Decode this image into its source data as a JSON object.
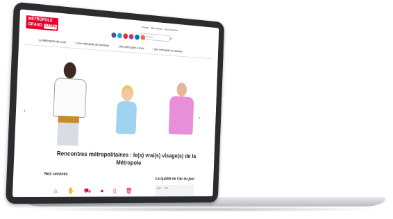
{
  "brand": {
    "line1": "MÉTROPOLE",
    "line2a": "GRAND",
    "line2b": "LYON"
  },
  "colors": {
    "accent": "#e4002b"
  },
  "header": {
    "top_links": [
      "Presse",
      "Aide et accès",
      "Nous contacter"
    ],
    "search_placeholder": "Rechercher",
    "social_icons": [
      "facebook-icon",
      "twitter-icon",
      "youtube-icon",
      "instagram-icon",
      "linkedin-icon",
      "rss-icon"
    ]
  },
  "nav": [
    "La Métropole de Lyon",
    "Une métropole de services",
    "Une métropole à vivre",
    "Une métropole en actions"
  ],
  "hero": {
    "title_line1": "Rencontres métropolitaines : le(s) vrai(s) visage(s) de la",
    "title_line2": "Métropole"
  },
  "services": {
    "title": "Nos services",
    "icons": [
      "home-icon",
      "hand-icon",
      "car-icon",
      "water-drop-icon",
      "bin-icon",
      "trash-icon"
    ]
  },
  "air": {
    "title": "La qualité de l'air du jour",
    "label": "Lyon",
    "value": "bon"
  }
}
